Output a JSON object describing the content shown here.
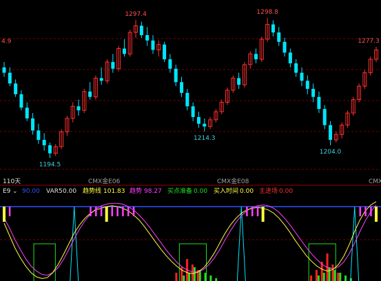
{
  "colors": {
    "background": "#000000",
    "up": "#FF3030",
    "down": "#00E5FF",
    "grid": "#7A0000",
    "separator": "#A00000",
    "ref_line": "#3050FF",
    "label_peak": "#FF5050",
    "label_trough": "#40D0E0",
    "yellow": "#FFFF40",
    "magenta": "#FF40FF",
    "green": "#20E020",
    "red": "#FF2020",
    "cyan": "#00E5FF",
    "text": "#E0E0E0"
  },
  "main_panel": {
    "period_label": "110天",
    "xaxis_labels": [
      "CMX金E06",
      "CMX金E08",
      "CMX"
    ],
    "peak_labels": [
      "4.9",
      "1297.4",
      "1298.8",
      "1277.3"
    ],
    "trough_labels": [
      "1194.5",
      "1214.3",
      "1204.0"
    ]
  },
  "indicator_panel": {
    "name": "E9",
    "dropdown_icon": "chevron-down-icon",
    "first_value": "90.00",
    "items": [
      {
        "label": "VAR5",
        "value": "0.00",
        "color": "#E0E0E0"
      },
      {
        "label": "趋势线",
        "value": "101.83",
        "color": "#FFFF40"
      },
      {
        "label": "趋势",
        "value": "98.27",
        "color": "#FF40FF"
      },
      {
        "label": "买点准备",
        "value": "0.00",
        "color": "#20E020"
      },
      {
        "label": "买入时间",
        "value": "0.00",
        "color": "#FFFF40"
      },
      {
        "label": "主进场",
        "value": "0.00",
        "color": "#FF3030"
      }
    ]
  },
  "chart_data": [
    {
      "type": "candlestick",
      "title": "CMX金",
      "period": "110天",
      "annotations": [
        {
          "label": "1297.4",
          "kind": "high"
        },
        {
          "label": "1214.3",
          "kind": "low"
        },
        {
          "label": "1298.8",
          "kind": "high"
        },
        {
          "label": "1204.0",
          "kind": "low"
        },
        {
          "label": "1277.3",
          "kind": "high"
        },
        {
          "label": "1194.5",
          "kind": "low"
        }
      ],
      "ylim": [
        1186,
        1306
      ],
      "x_labels": [
        "CMX金E06",
        "CMX金E08",
        "CMX"
      ],
      "candles": [
        {
          "o": 1262,
          "h": 1266,
          "l": 1255,
          "c": 1258
        },
        {
          "o": 1258,
          "h": 1262,
          "l": 1248,
          "c": 1250
        },
        {
          "o": 1250,
          "h": 1253,
          "l": 1240,
          "c": 1242
        },
        {
          "o": 1242,
          "h": 1245,
          "l": 1230,
          "c": 1232
        },
        {
          "o": 1232,
          "h": 1236,
          "l": 1222,
          "c": 1224
        },
        {
          "o": 1224,
          "h": 1228,
          "l": 1212,
          "c": 1215
        },
        {
          "o": 1215,
          "h": 1220,
          "l": 1205,
          "c": 1208
        },
        {
          "o": 1208,
          "h": 1213,
          "l": 1200,
          "c": 1204
        },
        {
          "o": 1204,
          "h": 1206,
          "l": 1194.5,
          "c": 1198
        },
        {
          "o": 1198,
          "h": 1205,
          "l": 1196,
          "c": 1203
        },
        {
          "o": 1203,
          "h": 1216,
          "l": 1201,
          "c": 1214
        },
        {
          "o": 1214,
          "h": 1226,
          "l": 1211,
          "c": 1224
        },
        {
          "o": 1224,
          "h": 1236,
          "l": 1221,
          "c": 1233
        },
        {
          "o": 1233,
          "h": 1238,
          "l": 1226,
          "c": 1230
        },
        {
          "o": 1230,
          "h": 1246,
          "l": 1228,
          "c": 1244
        },
        {
          "o": 1244,
          "h": 1251,
          "l": 1238,
          "c": 1240
        },
        {
          "o": 1240,
          "h": 1256,
          "l": 1238,
          "c": 1254
        },
        {
          "o": 1254,
          "h": 1262,
          "l": 1249,
          "c": 1252
        },
        {
          "o": 1252,
          "h": 1268,
          "l": 1250,
          "c": 1266
        },
        {
          "o": 1266,
          "h": 1272,
          "l": 1258,
          "c": 1261
        },
        {
          "o": 1261,
          "h": 1278,
          "l": 1259,
          "c": 1276
        },
        {
          "o": 1276,
          "h": 1283,
          "l": 1270,
          "c": 1272
        },
        {
          "o": 1272,
          "h": 1290,
          "l": 1270,
          "c": 1288
        },
        {
          "o": 1288,
          "h": 1297.4,
          "l": 1284,
          "c": 1293
        },
        {
          "o": 1293,
          "h": 1296,
          "l": 1284,
          "c": 1286
        },
        {
          "o": 1286,
          "h": 1292,
          "l": 1278,
          "c": 1282
        },
        {
          "o": 1282,
          "h": 1286,
          "l": 1272,
          "c": 1275
        },
        {
          "o": 1275,
          "h": 1282,
          "l": 1270,
          "c": 1279
        },
        {
          "o": 1279,
          "h": 1281,
          "l": 1266,
          "c": 1268
        },
        {
          "o": 1268,
          "h": 1272,
          "l": 1258,
          "c": 1261
        },
        {
          "o": 1261,
          "h": 1264,
          "l": 1248,
          "c": 1251
        },
        {
          "o": 1251,
          "h": 1255,
          "l": 1240,
          "c": 1243
        },
        {
          "o": 1243,
          "h": 1246,
          "l": 1230,
          "c": 1233
        },
        {
          "o": 1233,
          "h": 1236,
          "l": 1222,
          "c": 1225
        },
        {
          "o": 1225,
          "h": 1229,
          "l": 1217,
          "c": 1220
        },
        {
          "o": 1220,
          "h": 1224,
          "l": 1214.3,
          "c": 1218
        },
        {
          "o": 1218,
          "h": 1225,
          "l": 1216,
          "c": 1223
        },
        {
          "o": 1223,
          "h": 1231,
          "l": 1221,
          "c": 1229
        },
        {
          "o": 1229,
          "h": 1238,
          "l": 1227,
          "c": 1236
        },
        {
          "o": 1236,
          "h": 1247,
          "l": 1234,
          "c": 1245
        },
        {
          "o": 1245,
          "h": 1256,
          "l": 1243,
          "c": 1254
        },
        {
          "o": 1254,
          "h": 1258,
          "l": 1246,
          "c": 1249
        },
        {
          "o": 1249,
          "h": 1266,
          "l": 1247,
          "c": 1264
        },
        {
          "o": 1264,
          "h": 1274,
          "l": 1261,
          "c": 1272
        },
        {
          "o": 1272,
          "h": 1276,
          "l": 1265,
          "c": 1268
        },
        {
          "o": 1268,
          "h": 1285,
          "l": 1266,
          "c": 1283
        },
        {
          "o": 1283,
          "h": 1298.8,
          "l": 1281,
          "c": 1294
        },
        {
          "o": 1294,
          "h": 1297,
          "l": 1285,
          "c": 1288
        },
        {
          "o": 1288,
          "h": 1292,
          "l": 1278,
          "c": 1281
        },
        {
          "o": 1281,
          "h": 1284,
          "l": 1270,
          "c": 1273
        },
        {
          "o": 1273,
          "h": 1276,
          "l": 1262,
          "c": 1265
        },
        {
          "o": 1265,
          "h": 1268,
          "l": 1255,
          "c": 1258
        },
        {
          "o": 1258,
          "h": 1262,
          "l": 1248,
          "c": 1252
        },
        {
          "o": 1252,
          "h": 1256,
          "l": 1242,
          "c": 1246
        },
        {
          "o": 1246,
          "h": 1250,
          "l": 1236,
          "c": 1240
        },
        {
          "o": 1240,
          "h": 1244,
          "l": 1228,
          "c": 1231
        },
        {
          "o": 1231,
          "h": 1234,
          "l": 1216,
          "c": 1219
        },
        {
          "o": 1219,
          "h": 1222,
          "l": 1204,
          "c": 1208
        },
        {
          "o": 1208,
          "h": 1214,
          "l": 1206,
          "c": 1212
        },
        {
          "o": 1212,
          "h": 1221,
          "l": 1209,
          "c": 1219
        },
        {
          "o": 1219,
          "h": 1230,
          "l": 1217,
          "c": 1228
        },
        {
          "o": 1228,
          "h": 1240,
          "l": 1226,
          "c": 1238
        },
        {
          "o": 1238,
          "h": 1250,
          "l": 1236,
          "c": 1248
        },
        {
          "o": 1248,
          "h": 1260,
          "l": 1246,
          "c": 1258
        },
        {
          "o": 1258,
          "h": 1270,
          "l": 1256,
          "c": 1268
        },
        {
          "o": 1268,
          "h": 1277.3,
          "l": 1266,
          "c": 1275
        }
      ]
    },
    {
      "type": "indicator",
      "name": "E9",
      "series": [
        {
          "name": "趋势线",
          "values": [
            70,
            55,
            40,
            28,
            18,
            10,
            5,
            3,
            4,
            10,
            20,
            32,
            45,
            58,
            68,
            76,
            82,
            86,
            88,
            90,
            91,
            90,
            88,
            85,
            80,
            74,
            66,
            57,
            48,
            39,
            31,
            24,
            18,
            13,
            10,
            9,
            11,
            16,
            24,
            34,
            46,
            58,
            68,
            76,
            82,
            86,
            88,
            89,
            88,
            86,
            82,
            76,
            68,
            59,
            49,
            40,
            31,
            24,
            18,
            14,
            12,
            14,
            20,
            30,
            44,
            60,
            74,
            85,
            92,
            96
          ]
        },
        {
          "name": "趋势",
          "values": [
            76,
            64,
            50,
            38,
            27,
            18,
            12,
            8,
            7,
            10,
            16,
            26,
            38,
            51,
            63,
            73,
            81,
            87,
            91,
            93,
            94,
            94,
            93,
            90,
            86,
            80,
            73,
            65,
            56,
            47,
            38,
            30,
            23,
            17,
            13,
            11,
            11,
            14,
            20,
            28,
            38,
            50,
            61,
            71,
            79,
            85,
            89,
            91,
            92,
            91,
            88,
            83,
            76,
            68,
            59,
            50,
            41,
            33,
            26,
            20,
            16,
            15,
            17,
            23,
            33,
            46,
            60,
            73,
            84,
            92
          ]
        },
        {
          "name": "买点准备",
          "values": [
            0,
            0,
            0,
            0,
            0,
            0,
            1,
            1,
            1,
            1,
            0,
            0,
            0,
            0,
            0,
            0,
            0,
            0,
            0,
            0,
            0,
            0,
            0,
            0,
            0,
            0,
            0,
            0,
            0,
            0,
            0,
            0,
            0,
            1,
            1,
            1,
            1,
            1,
            0,
            0,
            0,
            0,
            0,
            0,
            0,
            0,
            0,
            0,
            0,
            0,
            0,
            0,
            0,
            0,
            0,
            0,
            0,
            1,
            1,
            1,
            1,
            1,
            0,
            0,
            0,
            0,
            0,
            0,
            0,
            0
          ]
        },
        {
          "name": "主进场",
          "values": [
            0,
            0,
            0,
            0,
            0,
            0,
            0,
            0,
            0,
            0,
            0,
            0,
            0,
            0,
            0,
            0,
            0,
            0,
            0,
            0,
            0,
            0,
            0,
            0,
            0,
            0,
            0,
            0,
            0,
            0,
            0,
            0,
            3,
            5,
            8,
            6,
            4,
            0,
            0,
            0,
            0,
            0,
            0,
            0,
            0,
            0,
            0,
            0,
            0,
            0,
            0,
            0,
            0,
            0,
            0,
            0,
            0,
            2,
            4,
            7,
            10,
            6,
            3,
            0,
            0,
            0,
            0,
            0,
            0,
            0
          ]
        },
        {
          "name": "green_bars",
          "values": [
            0,
            0,
            0,
            0,
            0,
            0,
            0,
            0,
            0,
            0,
            0,
            0,
            0,
            0,
            0,
            0,
            0,
            0,
            0,
            0,
            0,
            0,
            0,
            0,
            0,
            0,
            0,
            0,
            0,
            0,
            0,
            0,
            0,
            2,
            3,
            5,
            4,
            3,
            2,
            1,
            0,
            0,
            0,
            0,
            0,
            0,
            0,
            0,
            0,
            0,
            0,
            0,
            0,
            0,
            0,
            0,
            0,
            0,
            2,
            3,
            5,
            4,
            3,
            2,
            1,
            0,
            0,
            0,
            0,
            0
          ]
        },
        {
          "name": "cyan_spikes",
          "values": [
            0,
            0,
            0,
            0,
            0,
            0,
            0,
            0,
            0,
            0,
            0,
            0,
            0,
            90,
            0,
            0,
            0,
            0,
            0,
            0,
            0,
            0,
            0,
            0,
            0,
            0,
            0,
            0,
            0,
            0,
            0,
            0,
            0,
            0,
            0,
            0,
            0,
            0,
            0,
            0,
            0,
            0,
            0,
            0,
            90,
            0,
            0,
            0,
            0,
            0,
            0,
            0,
            0,
            0,
            0,
            0,
            0,
            0,
            0,
            0,
            0,
            0,
            0,
            0,
            0,
            90,
            0,
            0,
            0,
            0
          ]
        },
        {
          "name": "yellow_marks",
          "values": [
            1,
            0,
            0,
            0,
            0,
            0,
            0,
            0,
            0,
            0,
            0,
            0,
            0,
            0,
            0,
            0,
            0,
            0,
            0,
            1,
            0,
            0,
            0,
            0,
            0,
            0,
            0,
            0,
            0,
            0,
            0,
            0,
            0,
            0,
            0,
            0,
            0,
            0,
            0,
            0,
            0,
            0,
            0,
            0,
            0,
            0,
            0,
            0,
            1,
            0,
            0,
            0,
            0,
            0,
            0,
            0,
            0,
            0,
            0,
            0,
            0,
            0,
            0,
            0,
            0,
            0,
            0,
            0,
            0,
            1
          ]
        },
        {
          "name": "magenta_marks",
          "values": [
            0,
            1,
            0,
            0,
            0,
            0,
            0,
            0,
            0,
            0,
            0,
            0,
            0,
            0,
            0,
            0,
            1,
            1,
            1,
            0,
            1,
            1,
            1,
            1,
            1,
            0,
            0,
            0,
            0,
            0,
            0,
            0,
            0,
            0,
            0,
            0,
            0,
            0,
            0,
            0,
            0,
            0,
            0,
            0,
            0,
            1,
            1,
            1,
            0,
            0,
            0,
            0,
            0,
            0,
            0,
            0,
            0,
            0,
            0,
            0,
            0,
            0,
            0,
            0,
            0,
            0,
            1,
            1,
            1,
            0
          ]
        }
      ],
      "ref_line": 90,
      "ylim": [
        0,
        100
      ]
    }
  ]
}
